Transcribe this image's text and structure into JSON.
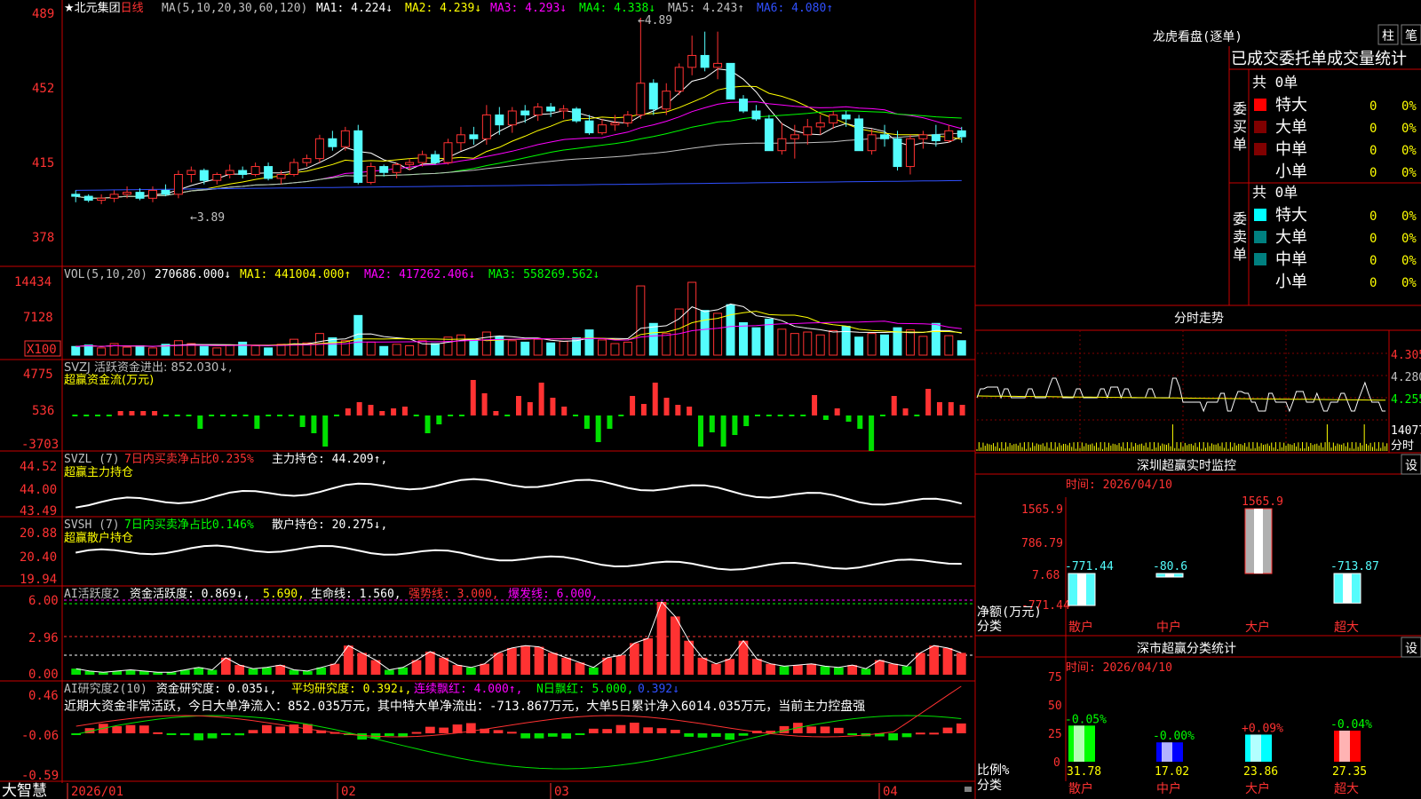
{
  "colors": {
    "up": "#ff3232",
    "down": "#54fcfc",
    "border": "#c80000",
    "ma1": "#ffffff",
    "ma2": "#ffff00",
    "ma3": "#ff00ff",
    "ma4": "#00ff00",
    "ma5": "#c0c0c0",
    "ma6": "#3050ff",
    "green": "#00e000",
    "yellow": "#ffff00",
    "magenta": "#ff00ff"
  },
  "footer": {
    "brand": "大智慧",
    "dates": [
      "2026/01",
      "02",
      "03",
      "04"
    ]
  },
  "main": {
    "title": "北元集团",
    "period": "日线",
    "ma_label": "MA(5,10,20,30,60,120)",
    "ma_values": [
      "MA1: 4.224↓",
      "MA2: 4.239↓",
      "MA3: 4.293↓",
      "MA4: 4.338↓",
      "MA5: 4.243↑",
      "MA6: 4.080↑"
    ],
    "yticks": [
      "489",
      "452",
      "415",
      "378"
    ],
    "hi_label": "4.89",
    "lo_label": "3.89"
  },
  "vol": {
    "label": "VOL(5,10,20)",
    "v": "270686.000↓",
    "ma1": "MA1: 441004.000↑",
    "ma2": "MA2: 417262.406↓",
    "ma3": "MA3: 558269.562↓",
    "yticks": [
      "14434",
      "7128"
    ],
    "unit": "X100"
  },
  "svzj": {
    "label": "SVZJ  活跃资金进出: 852.030↓,",
    "sub": "超赢资金流(万元)",
    "yticks": [
      "4775",
      "536",
      "-3703"
    ]
  },
  "svzl": {
    "label": "SVZL (7)",
    "pct": "7日内买卖净占比0.235%",
    "hold": "主力持仓: 44.209↑,",
    "sub": "超赢主力持仓",
    "yticks": [
      "44.52",
      "44.00",
      "43.49"
    ]
  },
  "svsh": {
    "label": "SVSH (7)",
    "pct": "7日内买卖净占比0.146%",
    "hold": "散户持仓: 20.275↓,",
    "sub": "超赢散户持仓",
    "yticks": [
      "20.88",
      "20.40",
      "19.94"
    ]
  },
  "ai1": {
    "label": "AI活跃度2",
    "a": "资金活跃度: 0.869↓,",
    "b": "5.690,",
    "c": "生命线: 1.560,",
    "d": "强势线: 3.000,",
    "e": "爆发线: 6.000,",
    "yticks": [
      "6.00",
      "2.96",
      "0.00"
    ]
  },
  "ai2": {
    "label": "AI研究度2(10)",
    "a": "资金研究度: 0.035↓,",
    "b": "平均研究度: 0.392↓,",
    "c": "连续飘红: 4.000↑,",
    "d": "N日飘红: 5.000,",
    "e": "0.392↓",
    "msg": "近期大资金非常活跃，今日大单净流入：852.035万元，其中特大单净流出：-713.867万元，大单5日累计净入6014.035万元，当前主力控盘强",
    "yticks": [
      "0.46",
      "-0.06",
      "-0.59"
    ]
  },
  "right": {
    "lhb_title": "龙虎看盘(逐单)",
    "btn_col": "柱",
    "btn_bi": "笔",
    "stat_title": "已成交委托单成交量统计",
    "buy_label": "委买单",
    "sell_label": "委卖单",
    "buy_total": "共 0单",
    "sell_total": "共 0单",
    "buy_rows": [
      {
        "name": "特大",
        "v": "0",
        "p": "0%"
      },
      {
        "name": "大单",
        "v": "0",
        "p": "0%"
      },
      {
        "name": "中单",
        "v": "0",
        "p": "0%"
      },
      {
        "name": "小单",
        "v": "0",
        "p": "0%"
      }
    ],
    "sell_rows": [
      {
        "name": "特大",
        "v": "0",
        "p": "0%"
      },
      {
        "name": "大单",
        "v": "0",
        "p": "0%"
      },
      {
        "name": "中单",
        "v": "0",
        "p": "0%"
      },
      {
        "name": "小单",
        "v": "0",
        "p": "0%"
      }
    ],
    "fs_title": "分时走势",
    "fs_yticks": [
      "4.305",
      "4.280",
      "4.255"
    ],
    "fs_vol": "14077",
    "fs_bottom": "分时",
    "sz_title": "深圳超赢实时监控",
    "sz_set": "设",
    "sz_time": "时间: 2026/04/10",
    "sz_yticks": [
      "1565.9",
      "786.79",
      "7.68",
      "-771.44"
    ],
    "sz_ylabel": "净额(万元)",
    "sz_xlabel": "分类",
    "sz_cats": [
      "散户",
      "中户",
      "大户",
      "超大"
    ],
    "sc_title": "深市超赢分类统计",
    "sc_set": "设",
    "sc_time": "时间: 2026/04/10",
    "sc_yticks": [
      "75",
      "50",
      "25",
      "0"
    ],
    "sc_ylabel": "比例%",
    "sc_xlabel": "分类",
    "sc_cats": [
      "散户",
      "中户",
      "大户",
      "超大"
    ]
  },
  "chart_data": [
    {
      "type": "bar",
      "title": "深圳超赢实时监控",
      "categories": [
        "散户",
        "中户",
        "大户",
        "超大"
      ],
      "values": [
        -771.44,
        -80.6,
        1565.9,
        -713.87
      ],
      "labels": [
        "-771.44",
        "-80.6",
        "1565.9",
        "-713.87"
      ],
      "ylim": [
        -771.44,
        1565.9
      ],
      "ylabel": "净额(万元)",
      "xlabel": "分类"
    },
    {
      "type": "bar",
      "title": "深市超赢分类统计",
      "categories": [
        "散户",
        "中户",
        "大户",
        "超大"
      ],
      "values": [
        31.78,
        17.02,
        23.86,
        27.35
      ],
      "changes": [
        "-0.05%",
        "-0.00%",
        "+0.09%",
        "-0.04%"
      ],
      "vals": [
        "31.78",
        "17.02",
        "23.86",
        "27.35"
      ],
      "ylim": [
        0,
        75
      ],
      "ylabel": "比例%",
      "xlabel": "分类"
    },
    {
      "type": "line",
      "title": "北元集团 日线",
      "ylim": [
        3.78,
        4.89
      ],
      "candles": [
        [
          4.0,
          4.02,
          3.96,
          3.99
        ],
        [
          3.99,
          4.0,
          3.96,
          3.97
        ],
        [
          3.97,
          4.0,
          3.95,
          3.98
        ],
        [
          3.98,
          4.02,
          3.96,
          4.0
        ],
        [
          4.0,
          4.04,
          3.98,
          4.01
        ],
        [
          4.01,
          4.03,
          3.97,
          3.98
        ],
        [
          3.98,
          4.04,
          3.96,
          4.02
        ],
        [
          4.02,
          4.05,
          3.99,
          4.0
        ],
        [
          4.0,
          4.12,
          3.98,
          4.1
        ],
        [
          4.1,
          4.14,
          4.06,
          4.12
        ],
        [
          4.12,
          4.13,
          4.05,
          4.07
        ],
        [
          4.07,
          4.11,
          4.05,
          4.1
        ],
        [
          4.1,
          4.15,
          4.08,
          4.12
        ],
        [
          4.12,
          4.14,
          4.08,
          4.1
        ],
        [
          4.1,
          4.16,
          4.09,
          4.14
        ],
        [
          4.14,
          4.16,
          4.07,
          4.08
        ],
        [
          4.08,
          4.12,
          4.05,
          4.1
        ],
        [
          4.1,
          4.18,
          4.09,
          4.16
        ],
        [
          4.16,
          4.2,
          4.14,
          4.18
        ],
        [
          4.18,
          4.3,
          4.16,
          4.28
        ],
        [
          4.28,
          4.32,
          4.22,
          4.24
        ],
        [
          4.24,
          4.34,
          4.22,
          4.32
        ],
        [
          4.32,
          4.35,
          4.05,
          4.06
        ],
        [
          4.06,
          4.16,
          4.05,
          4.14
        ],
        [
          4.14,
          4.15,
          4.09,
          4.11
        ],
        [
          4.11,
          4.16,
          4.08,
          4.15
        ],
        [
          4.15,
          4.18,
          4.12,
          4.16
        ],
        [
          4.16,
          4.22,
          4.14,
          4.2
        ],
        [
          4.2,
          4.22,
          4.15,
          4.16
        ],
        [
          4.16,
          4.28,
          4.15,
          4.26
        ],
        [
          4.26,
          4.34,
          4.22,
          4.3
        ],
        [
          4.3,
          4.34,
          4.25,
          4.28
        ],
        [
          4.28,
          4.45,
          4.25,
          4.4
        ],
        [
          4.4,
          4.44,
          4.3,
          4.35
        ],
        [
          4.35,
          4.44,
          4.31,
          4.42
        ],
        [
          4.42,
          4.45,
          4.36,
          4.4
        ],
        [
          4.4,
          4.46,
          4.37,
          4.44
        ],
        [
          4.44,
          4.46,
          4.39,
          4.42
        ],
        [
          4.42,
          4.45,
          4.38,
          4.43
        ],
        [
          4.43,
          4.44,
          4.36,
          4.37
        ],
        [
          4.37,
          4.4,
          4.3,
          4.31
        ],
        [
          4.31,
          4.38,
          4.3,
          4.35
        ],
        [
          4.35,
          4.4,
          4.32,
          4.36
        ],
        [
          4.36,
          4.42,
          4.34,
          4.4
        ],
        [
          4.4,
          4.89,
          4.38,
          4.56
        ],
        [
          4.56,
          4.58,
          4.4,
          4.43
        ],
        [
          4.43,
          4.56,
          4.4,
          4.52
        ],
        [
          4.52,
          4.66,
          4.5,
          4.64
        ],
        [
          4.64,
          4.8,
          4.6,
          4.7
        ],
        [
          4.7,
          4.82,
          4.62,
          4.64
        ],
        [
          4.64,
          4.82,
          4.58,
          4.66
        ],
        [
          4.66,
          4.66,
          4.48,
          4.48
        ],
        [
          4.48,
          4.5,
          4.41,
          4.42
        ],
        [
          4.42,
          4.45,
          4.37,
          4.38
        ],
        [
          4.38,
          4.4,
          4.22,
          4.22
        ],
        [
          4.22,
          4.36,
          4.2,
          4.28
        ],
        [
          4.28,
          4.35,
          4.18,
          4.3
        ],
        [
          4.3,
          4.38,
          4.25,
          4.34
        ],
        [
          4.34,
          4.4,
          4.3,
          4.36
        ],
        [
          4.36,
          4.42,
          4.33,
          4.4
        ],
        [
          4.4,
          4.42,
          4.34,
          4.38
        ],
        [
          4.38,
          4.4,
          4.22,
          4.22
        ],
        [
          4.22,
          4.33,
          4.2,
          4.3
        ],
        [
          4.3,
          4.35,
          4.24,
          4.28
        ],
        [
          4.28,
          4.32,
          4.12,
          4.14
        ],
        [
          4.14,
          4.3,
          4.1,
          4.28
        ],
        [
          4.28,
          4.32,
          4.23,
          4.3
        ],
        [
          4.3,
          4.35,
          4.24,
          4.27
        ],
        [
          4.27,
          4.35,
          4.26,
          4.32
        ],
        [
          4.32,
          4.34,
          4.26,
          4.29
        ]
      ],
      "vol": [
        12,
        14,
        10,
        16,
        11,
        13,
        10,
        15,
        20,
        16,
        12,
        10,
        14,
        18,
        13,
        10,
        15,
        22,
        17,
        30,
        24,
        20,
        55,
        18,
        12,
        15,
        13,
        20,
        16,
        25,
        28,
        22,
        32,
        26,
        20,
        18,
        22,
        17,
        19,
        24,
        35,
        21,
        16,
        18,
        96,
        44,
        30,
        64,
        101,
        62,
        58,
        70,
        45,
        38,
        50,
        36,
        30,
        32,
        28,
        34,
        40,
        25,
        30,
        28,
        38,
        35,
        26,
        44,
        27,
        20
      ],
      "svzj": [
        0,
        0,
        0,
        0,
        500,
        500,
        500,
        500,
        0,
        0,
        0,
        -1500,
        0,
        0,
        0,
        0,
        -1500,
        0,
        0,
        0,
        -1300,
        -2000,
        -3500,
        0,
        800,
        1500,
        1200,
        500,
        800,
        1000,
        0,
        -2000,
        -1000,
        0,
        0,
        4000,
        2500,
        500,
        0,
        2200,
        1500,
        3700,
        2000,
        1000,
        0,
        -1500,
        -3000,
        -1500,
        0,
        2200,
        1300,
        3700,
        2000,
        1200,
        1000,
        -3500,
        -1900,
        -3500,
        -2200,
        -1200,
        0,
        0,
        0,
        0,
        0,
        2300,
        -500,
        800,
        -700,
        -1500,
        -4000,
        0,
        2200,
        800,
        0,
        3000,
        1500,
        1500,
        1200
      ],
      "ai1": [
        0.5,
        0.3,
        0.2,
        0.3,
        0.4,
        0.3,
        0.2,
        0.2,
        0.4,
        0.6,
        0.4,
        1.4,
        0.8,
        0.5,
        0.6,
        0.8,
        0.4,
        0.3,
        0.6,
        0.9,
        2.4,
        1.8,
        1.2,
        0.4,
        0.6,
        1.2,
        1.9,
        1.4,
        0.8,
        0.6,
        0.9,
        1.8,
        2.2,
        2.4,
        2.3,
        1.8,
        1.4,
        1.0,
        0.6,
        1.4,
        1.6,
        2.6,
        3.0,
        6.0,
        4.8,
        2.8,
        1.4,
        0.9,
        1.3,
        2.8,
        1.3,
        0.9,
        0.7,
        0.8,
        0.9,
        0.7,
        0.6,
        0.8,
        0.5,
        1.2,
        0.9,
        0.7,
        1.8,
        2.4,
        2.2,
        1.8
      ]
    }
  ]
}
